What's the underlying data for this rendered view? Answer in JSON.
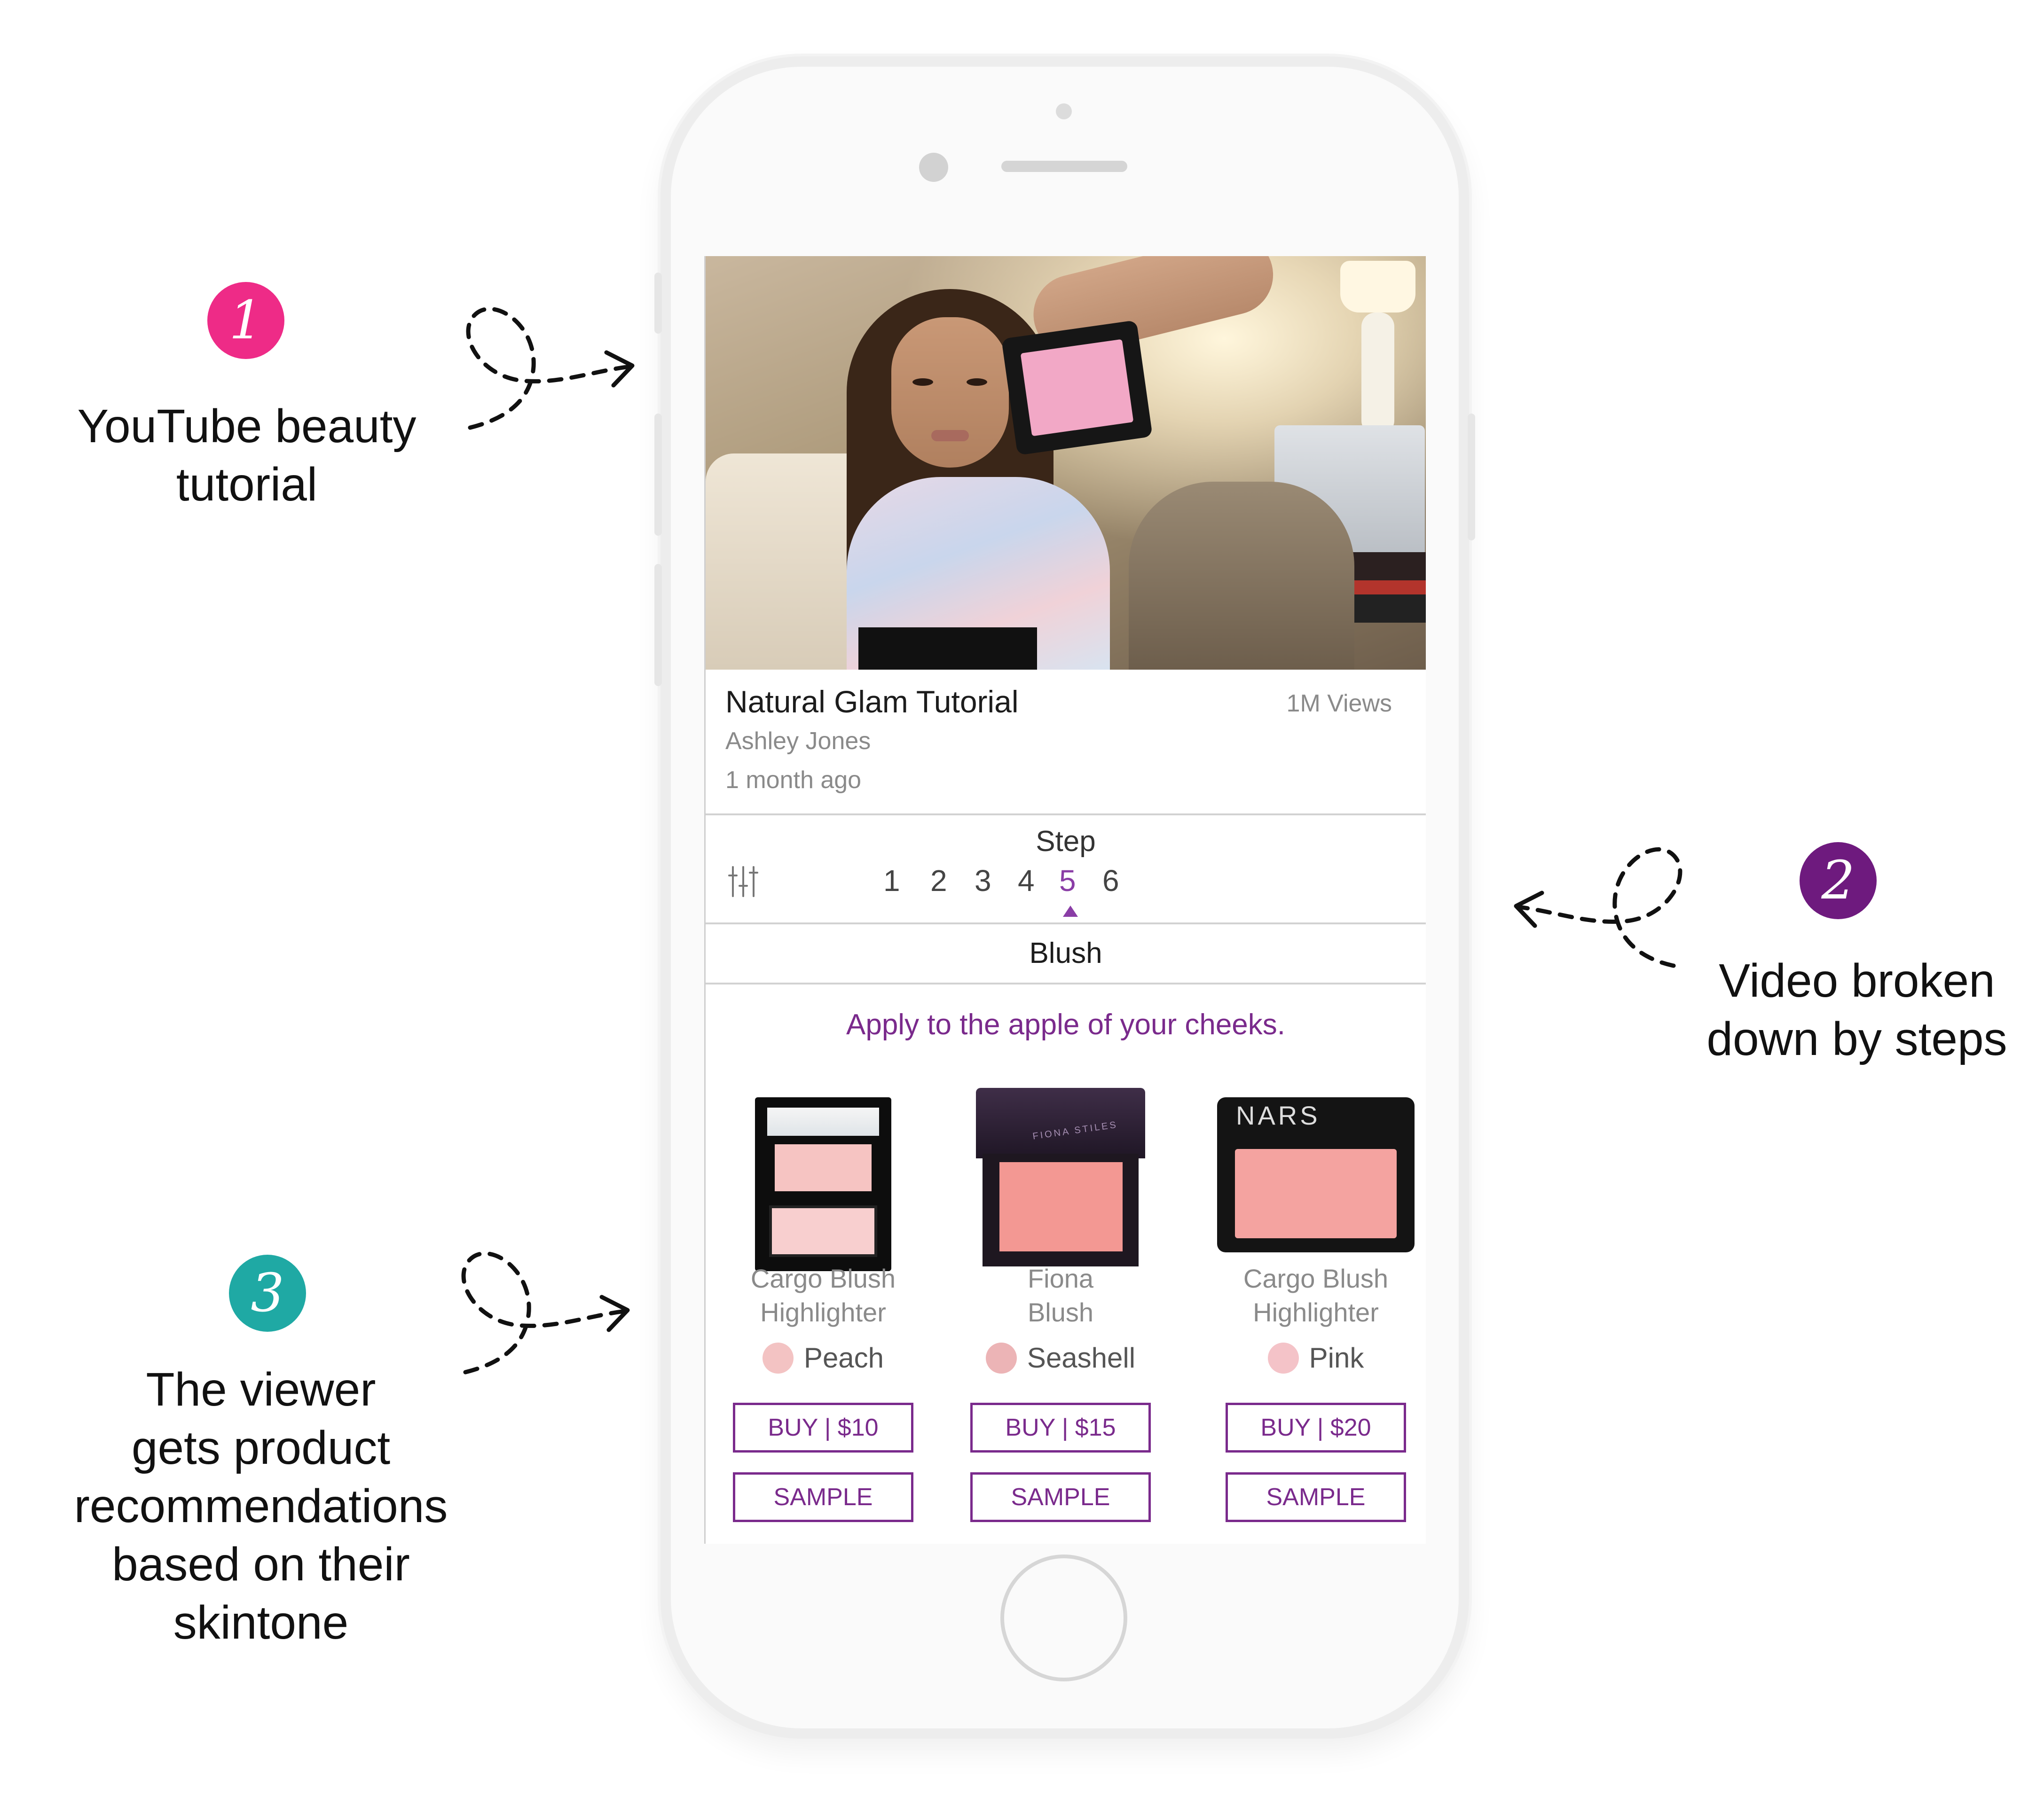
{
  "callouts": [
    {
      "number": "1",
      "lines": [
        "YouTube beauty",
        "tutorial"
      ],
      "color": "#ee2b87"
    },
    {
      "number": "2",
      "lines": [
        "Video broken",
        "down by steps"
      ],
      "color": "#6e1a7e"
    },
    {
      "number": "3",
      "lines": [
        "The viewer",
        "gets product",
        "recommendations",
        "based on their",
        "skintone"
      ],
      "color": "#1fa9a4"
    }
  ],
  "video": {
    "title": "Natural Glam Tutorial",
    "channel": "Ashley Jones",
    "posted": "1 month ago",
    "views": "1M Views"
  },
  "steps": {
    "label": "Step",
    "numbers": [
      "1",
      "2",
      "3",
      "4",
      "5",
      "6"
    ],
    "active": "5",
    "filter_icon": "sliders-icon"
  },
  "section_title": "Blush",
  "instruction": "Apply to the apple of your cheeks.",
  "accent_color": "#7a2a8c",
  "products": [
    {
      "name_lines": [
        "Cargo Blush",
        "Highlighter"
      ],
      "shade": "Peach",
      "shade_color": "#f3c3c3",
      "buy_label": "BUY | $10",
      "sample_label": "SAMPLE"
    },
    {
      "name_lines": [
        "Fiona",
        "Blush"
      ],
      "shade": "Seashell",
      "shade_color": "#ecb4b6",
      "buy_label": "BUY | $15",
      "sample_label": "SAMPLE",
      "brand_text": "FIONA STILES"
    },
    {
      "name_lines": [
        "Cargo Blush",
        "Highlighter"
      ],
      "shade": "Pink",
      "shade_color": "#f4c3c8",
      "buy_label": "BUY | $20",
      "sample_label": "SAMPLE",
      "brand_text": "NARS"
    }
  ]
}
